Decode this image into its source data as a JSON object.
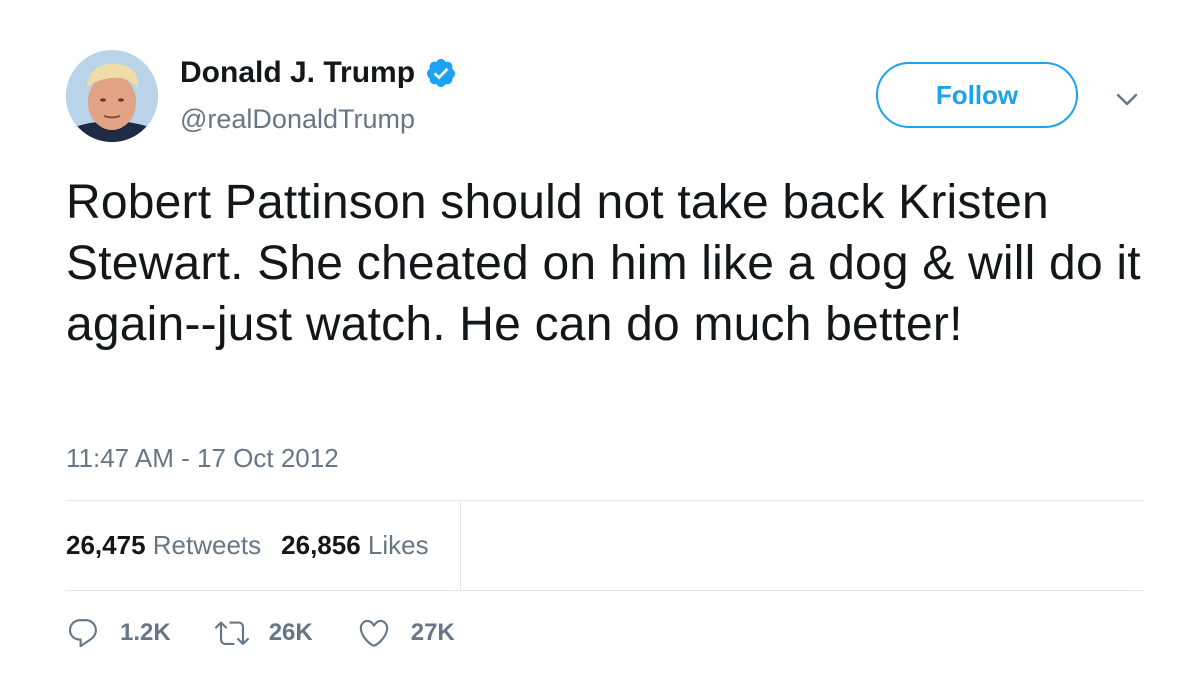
{
  "author": {
    "name": "Donald J. Trump",
    "handle": "@realDonaldTrump",
    "verified_icon": "verified-badge-icon",
    "avatar_icon": "avatar"
  },
  "follow_label": "Follow",
  "tweet_text": "Robert Pattinson should not take back Kristen Stewart. She cheated on him like a dog & will do it again--just watch. He can do much better!",
  "timestamp": "11:47 AM - 17 Oct 2012",
  "stats": {
    "retweets_count": "26,475",
    "retweets_label": "Retweets",
    "likes_count": "26,856",
    "likes_label": "Likes"
  },
  "actions": {
    "reply_count": "1.2K",
    "retweet_count": "26K",
    "like_count": "27K"
  },
  "colors": {
    "accent": "#1da1f2",
    "text": "#14171a",
    "muted": "#657786",
    "divider": "#e1e8ed"
  }
}
